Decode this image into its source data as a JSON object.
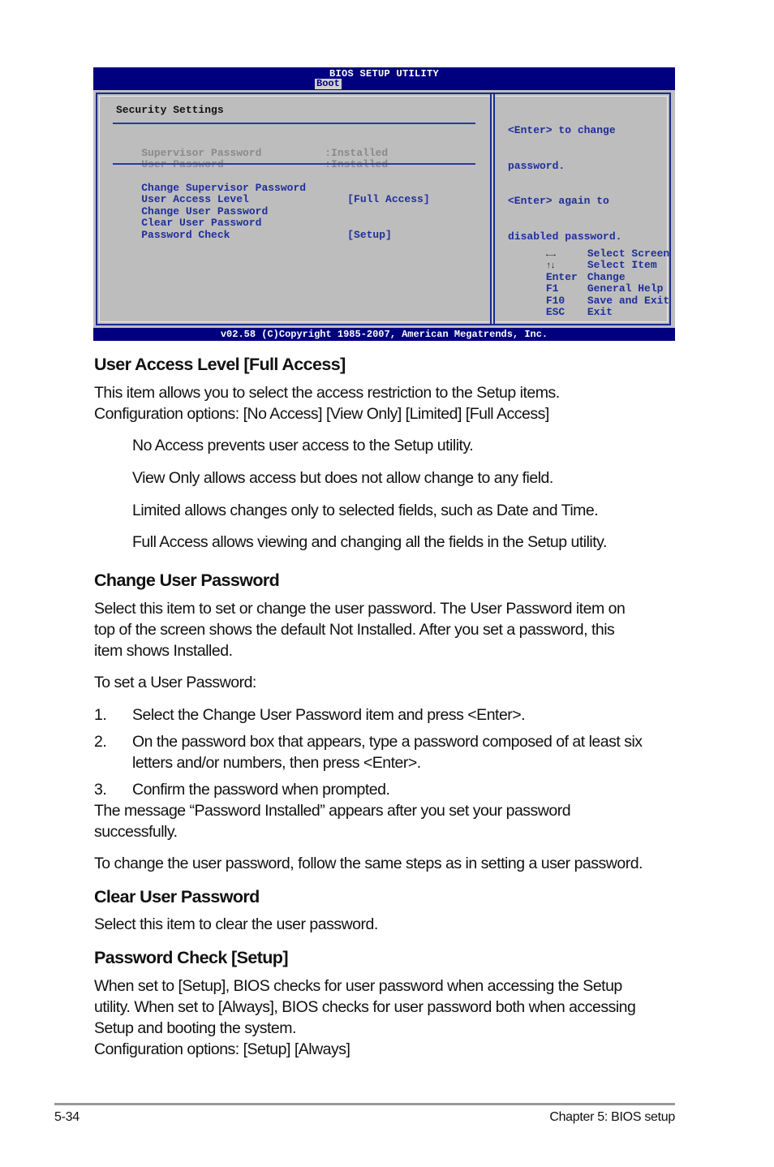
{
  "bios": {
    "title": "BIOS SETUP UTILITY",
    "active_tab": "Boot",
    "section_title": "Security Settings",
    "status_items": [
      {
        "label": "Supervisor Password",
        "value": ":Installed"
      },
      {
        "label": "User Password",
        "value": ":Installed"
      }
    ],
    "menu_items": [
      {
        "label": "Change Supervisor Password",
        "value": ""
      },
      {
        "label": "User Access Level",
        "value": "[Full Access]"
      },
      {
        "label": "Change User Password",
        "value": ""
      },
      {
        "label": "Clear User Password",
        "value": ""
      },
      {
        "label": "Password Check",
        "value": "[Setup]"
      }
    ],
    "help_text": [
      "<Enter> to change",
      "password.",
      "<Enter> again to",
      "disabled password."
    ],
    "key_legend": [
      {
        "key": "←→",
        "key_icon": "left-right-arrows-icon",
        "action": "Select Screen"
      },
      {
        "key": "↑↓",
        "key_icon": "up-down-arrows-icon",
        "action": "Select Item"
      },
      {
        "key": "Enter",
        "action": "Change"
      },
      {
        "key": "F1",
        "action": "General Help"
      },
      {
        "key": "F10",
        "action": "Save and Exit"
      },
      {
        "key": "ESC",
        "action": "Exit"
      }
    ],
    "copyright": "v02.58 (C)Copyright 1985-2007, American Megatrends, Inc."
  },
  "doc": {
    "sections": {
      "user_access": {
        "heading": "User Access Level [Full Access]",
        "para": [
          "This item allows you to select the access restriction to the Setup items.",
          "Configuration options: [No Access] [View Only] [Limited] [Full Access]"
        ],
        "options": [
          "No Access prevents user access to the Setup utility.",
          "View Only allows access but does not allow change to any field.",
          "Limited allows changes only to selected fields, such as Date and Time.",
          "Full Access allows viewing and changing all the fields in the Setup utility."
        ]
      },
      "change_user_password": {
        "heading": "Change User Password",
        "para": [
          "Select this item to set or change the user password. The User Password item on",
          "top of the screen shows the default Not Installed. After you set a password, this",
          "item shows Installed."
        ],
        "intro": "To set a User Password:",
        "steps": [
          {
            "num": "1.",
            "lines": [
              "Select the Change User Password item and press <Enter>."
            ]
          },
          {
            "num": "2.",
            "lines": [
              "On the password box that appears, type a password composed of at least six",
              "letters and/or numbers, then press <Enter>."
            ]
          },
          {
            "num": "3.",
            "lines": [
              "Confirm the password when prompted."
            ]
          }
        ],
        "after": [
          "The message “Password Installed” appears after you set your password",
          "successfully."
        ],
        "change_note": "To change the user password, follow the same steps as in setting a user password."
      },
      "clear_user_password": {
        "heading": "Clear User Password",
        "para": "Select this item to clear the user password."
      },
      "password_check": {
        "heading": "Password Check [Setup]",
        "para": [
          "When set to [Setup], BIOS checks for user password when accessing the Setup",
          "utility. When set to [Always], BIOS checks for user password both when accessing",
          "Setup and booting the system.",
          "Configuration options: [Setup] [Always]"
        ]
      }
    }
  },
  "footer": {
    "page_number": "5-34",
    "chapter": "Chapter 5: BIOS setup"
  },
  "colors": {
    "bios_navy": "#00007f",
    "bios_grey": "#bdbdbd",
    "bios_text_blue": "#1f2f9a",
    "bios_disabled_grey": "#8a8a8a"
  }
}
